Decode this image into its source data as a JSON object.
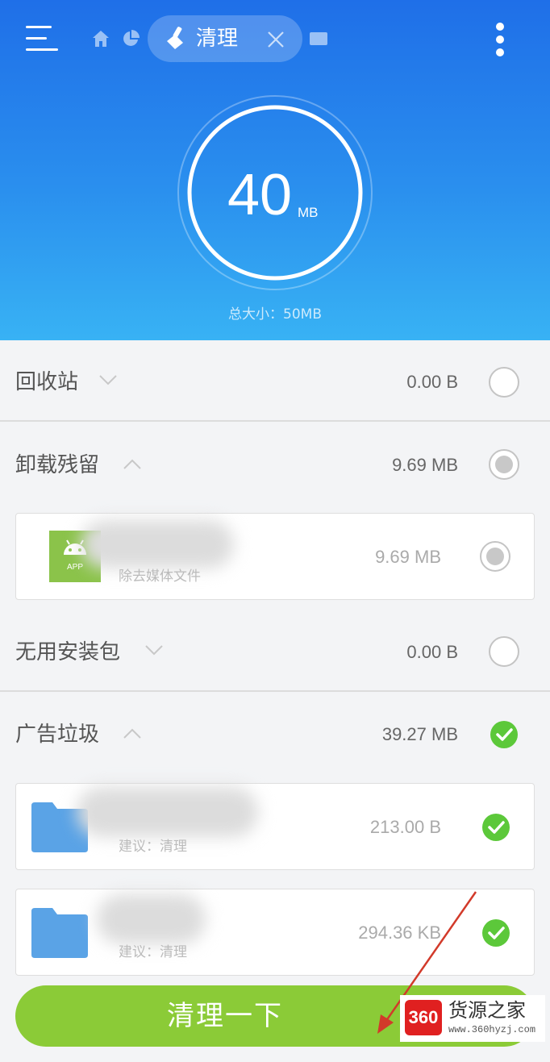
{
  "header": {
    "active_tab": "清理",
    "gauge_value": "40",
    "gauge_unit": "MB",
    "total_size": "总大小：50MB"
  },
  "sections": [
    {
      "title": "回收站",
      "size": "0.00 B",
      "state": "unchecked",
      "expanded": false
    },
    {
      "title": "卸载残留",
      "size": "9.69 MB",
      "state": "partial",
      "expanded": true
    },
    {
      "title": "无用安装包",
      "size": "0.00 B",
      "state": "unchecked",
      "expanded": false
    },
    {
      "title": "广告垃圾",
      "size": "39.27 MB",
      "state": "checked",
      "expanded": true
    }
  ],
  "items": [
    {
      "subtitle": "除去媒体文件",
      "size": "9.69 MB",
      "icon": "android-app-icon",
      "tile_label": "APP",
      "state": "partial"
    },
    {
      "subtitle": "建议：清理",
      "size": "213.00 B",
      "icon": "folder-icon",
      "state": "checked"
    },
    {
      "subtitle": "建议：清理",
      "size": "294.36 KB",
      "icon": "folder-icon",
      "state": "checked"
    }
  ],
  "primary_button": "清理一下",
  "watermark": {
    "logo": "360",
    "name": "货源之家",
    "url": "www.360hyzj.com"
  },
  "colors": {
    "header_top": "#1f6fe8",
    "header_bottom": "#38b2f4",
    "accent_green": "#5cc83a",
    "button_green": "#8bcb37"
  }
}
